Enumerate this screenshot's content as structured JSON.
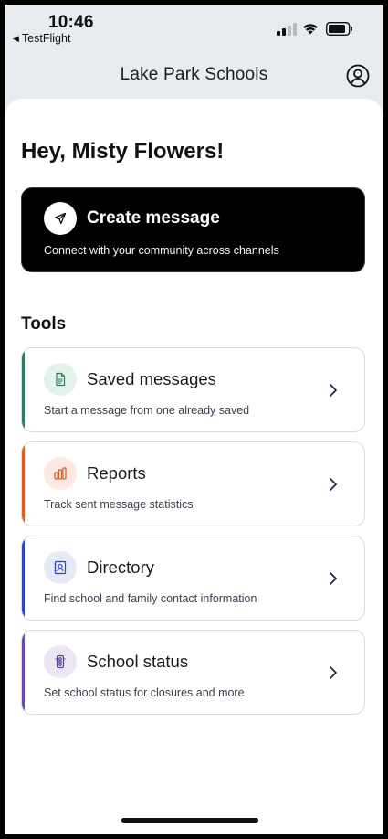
{
  "status_bar": {
    "time": "10:46",
    "back_app": "TestFlight",
    "back_arrow": "◀"
  },
  "nav": {
    "title": "Lake Park Schools",
    "profile_icon": "user-circle-icon"
  },
  "greeting": "Hey, Misty Flowers!",
  "create_message": {
    "title": "Create message",
    "subtitle": "Connect with your community across channels",
    "icon": "send-icon"
  },
  "tools": {
    "heading": "Tools",
    "items": [
      {
        "title": "Saved messages",
        "subtitle": "Start a message from one already saved",
        "icon": "document-icon",
        "accent": "#2e7d5b",
        "icon_bg": "#e3f3ec",
        "icon_color": "#2e7d5b"
      },
      {
        "title": "Reports",
        "subtitle": "Track sent message statistics",
        "icon": "bar-chart-icon",
        "accent": "#e0592a",
        "icon_bg": "#fbe9e2",
        "icon_color": "#d9552a"
      },
      {
        "title": "Directory",
        "subtitle": "Find school and family contact information",
        "icon": "contact-card-icon",
        "accent": "#2d46b9",
        "icon_bg": "#e6eaf6",
        "icon_color": "#2d46b9"
      },
      {
        "title": "School status",
        "subtitle": "Set school status for closures and more",
        "icon": "traffic-light-icon",
        "accent": "#6b4aa8",
        "icon_bg": "#ece6f4",
        "icon_color": "#5b3f95"
      }
    ]
  }
}
